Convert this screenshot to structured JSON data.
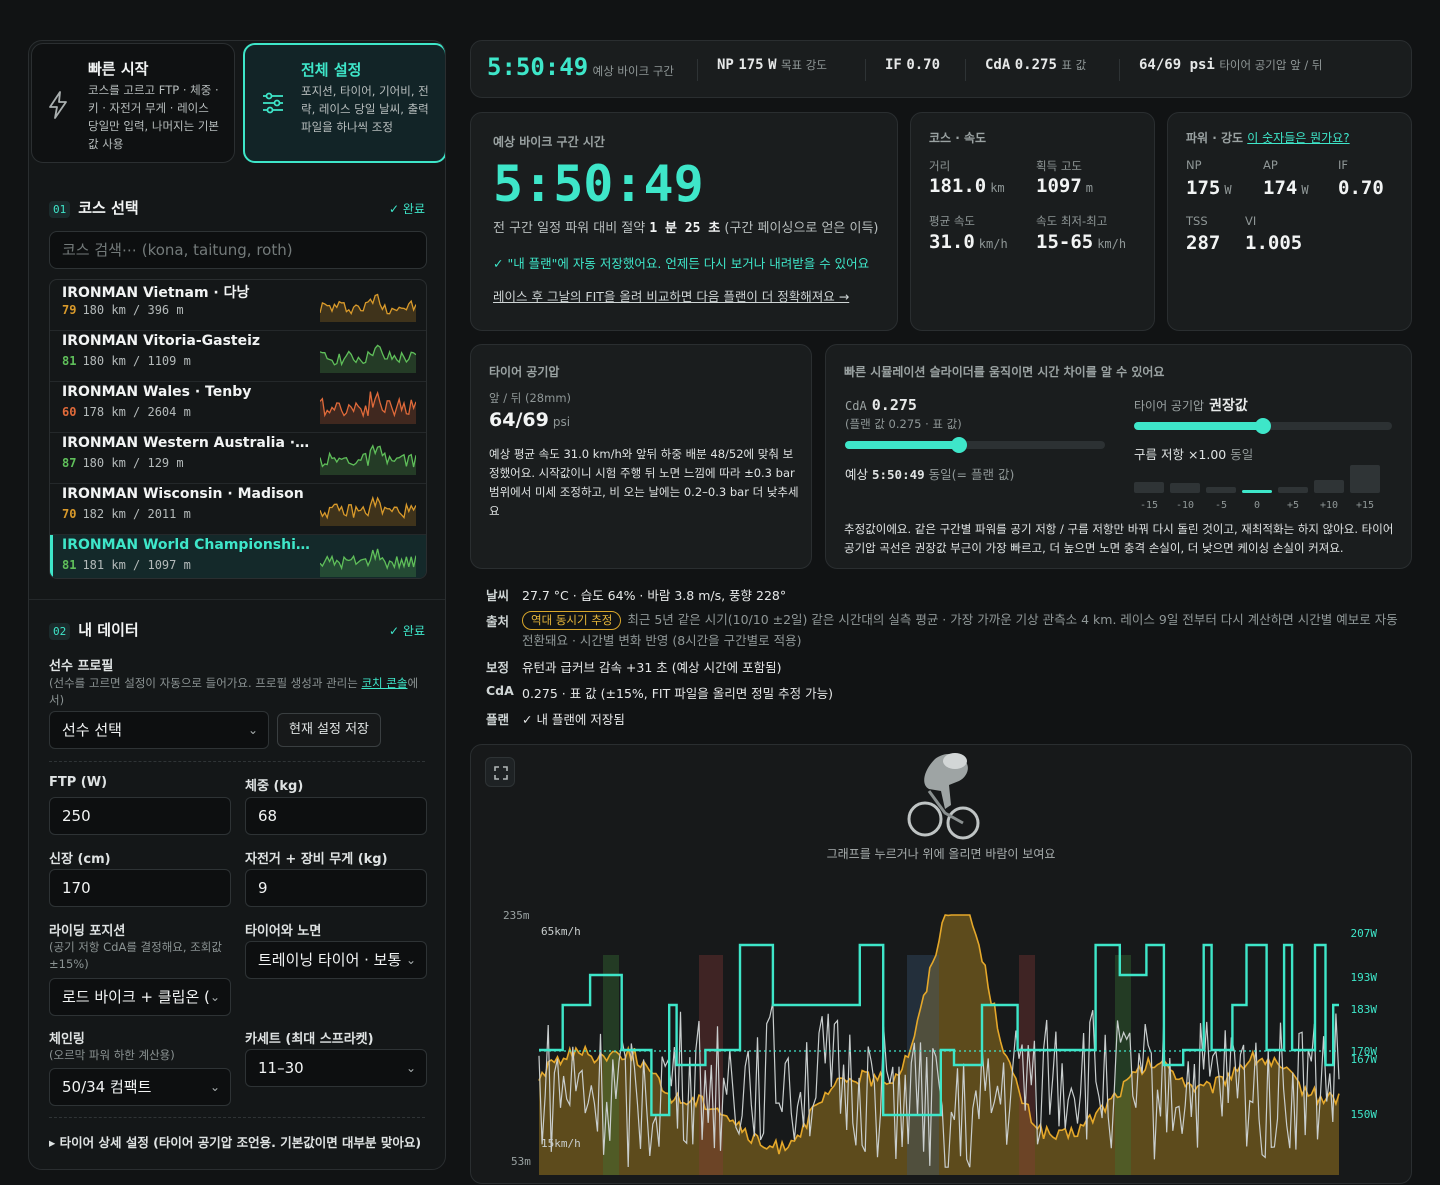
{
  "modes": {
    "quick": {
      "icon": "lightning-icon",
      "title": "빠른 시작",
      "desc": "코스를 고르고 FTP · 체중 · 키 · 자전거 무게 · 레이스 당일만 입력, 나머지는 기본값 사용"
    },
    "full": {
      "icon": "sliders-icon",
      "title": "전체 설정",
      "desc": "포지션, 타이어, 기어비, 전략, 레이스 당일 날씨, 출력 파일을 하나씩 조정"
    }
  },
  "course_section": {
    "num": "01",
    "title": "코스 선택",
    "done": "✓ 완료",
    "search_placeholder": "코스 검색⋯ (kona, taitung, roth)",
    "courses": [
      {
        "name": "IRONMAN Vietnam · 다낭",
        "score": "79",
        "meta": "180 km / 396 m",
        "color": "#d99a2b"
      },
      {
        "name": "IRONMAN Vitoria-Gasteiz",
        "score": "81",
        "meta": "180 km / 1109 m",
        "color": "#5fbf5a"
      },
      {
        "name": "IRONMAN Wales · Tenby",
        "score": "60",
        "meta": "178 km / 2604 m",
        "color": "#e06a3a"
      },
      {
        "name": "IRONMAN Western Australia · Bus⋯",
        "score": "87",
        "meta": "180 km / 129 m",
        "color": "#5fbf5a"
      },
      {
        "name": "IRONMAN Wisconsin · Madison",
        "score": "70",
        "meta": "182 km / 2011 m",
        "color": "#d99a2b"
      },
      {
        "name": "IRONMAN World Championship · ⋯",
        "score": "81",
        "meta": "181 km / 1097 m",
        "color": "#5fbf5a"
      }
    ]
  },
  "data_section": {
    "num": "02",
    "title": "내 데이터",
    "done": "✓ 완료",
    "profile_label": "선수 프로필",
    "profile_sub_a": "(선수를 고르면 설정이 자동으로 들어가요. 프로필 생성과 관리는 ",
    "profile_link": "코치 콘솔",
    "profile_sub_b": "에서)",
    "athlete_select": "선수 선택",
    "save_button": "현재 설정 저장",
    "ftp_label": "FTP  (W)",
    "ftp": "250",
    "weight_label": "체중 (kg)",
    "weight": "68",
    "height_label": "신장 (cm)",
    "height": "170",
    "bike_weight_label": "자전거 + 장비 무게 (kg)",
    "bike_weight": "9",
    "position_label": "라이딩 포지션",
    "position_sub": "(공기 저항 CdA를 결정해요, 조회값 ±15%)",
    "position": "로드 바이크 + 클립온 (",
    "tire_label": "타이어와 노면",
    "tire": "트레이닝 타이어 · 보통",
    "chainring_label": "체인링",
    "chainring_sub": "(오르막 파워 하한 계산용)",
    "chainring": "50/34 컴팩트",
    "cassette_label": "카세트 (최대 스프라켓)",
    "cassette": "11–30",
    "tire_detail": "▸ 타이어 상세 설정 (타이어 공기압 조언용. 기본값이면 대부분 맞아요)"
  },
  "topbar": {
    "time": "5:50:49",
    "time_cap": "예상 바이크 구간",
    "np_label": "NP",
    "np": "175",
    "np_unit": "W",
    "np_cap": "목표 강도",
    "if_label": "IF",
    "if": "0.70",
    "cda_label": "CdA",
    "cda": "0.275",
    "cda_cap": "표 값",
    "psi": "64/69 psi",
    "psi_cap": "타이어 공기압 앞 / 뒤"
  },
  "time_card": {
    "cap": "예상 바이크 구간 시간",
    "time": "5:50:49",
    "save_a": "전 구간 일정 파워 대비 절약 ",
    "save_val": "1 분 25 초",
    "save_b": " (구간 페이싱으로 얻은 이득)",
    "saved": "✓ \"내 플랜\"에 자동 저장했어요. 언제든 다시 보거나 내려받을 수 있어요",
    "fit_link": "레이스 후 그날의 FIT을 올려 비교하면 다음 플랜이 더 정확해져요 →"
  },
  "course_card": {
    "cap": "코스 · 속도",
    "dist_label": "거리",
    "dist": "181.0",
    "dist_unit": "km",
    "gain_label": "획득 고도",
    "gain": "1097",
    "gain_unit": "m",
    "avg_label": "평균 속도",
    "avg": "31.0",
    "avg_unit": "km/h",
    "range_label": "속도 최저-최고",
    "range": "15-65",
    "range_unit": "km/h"
  },
  "power_card": {
    "cap": "파워 · 강도",
    "link": "이 숫자들은 뭔가요?",
    "np_label": "NP",
    "np": "175",
    "np_unit": "W",
    "ap_label": "AP",
    "ap": "174",
    "ap_unit": "W",
    "if_label": "IF",
    "if": "0.70",
    "tss_label": "TSS",
    "tss": "287",
    "vi_label": "VI",
    "vi": "1.005"
  },
  "tire_card": {
    "cap": "타이어 공기압",
    "sub": "앞 / 뒤 (28mm)",
    "front": "64",
    "rear": "/69",
    "unit": "psi",
    "desc": "예상 평균 속도 31.0 km/h와 앞뒤 하중 배분 48/52에 맞춰 보정했어요. 시작값이니 시험 주행 뒤 노면 느낌에 따라 ±0.3 bar 범위에서 미세 조정하고, 비 오는 날에는 0.2–0.3 bar 더 낮추세요"
  },
  "sim_card": {
    "cap": "빠른 시뮬레이션 슬라이더를 움직이면 시간 차이를 알 수 있어요",
    "cda_label": "CdA",
    "cda": "0.275",
    "cda_sub": "(플랜 값 0.275 · 표 값)",
    "cda_level": 0.44,
    "result_a": "예상 ",
    "result_time": "5:50:49",
    "result_b": " 동일(= 플랜 값)",
    "tire_label": "타이어 공기압",
    "tire_val": "권장값",
    "tire_level": 0.5,
    "rr_a": "구름 저항 ×1.00",
    "rr_b": " 동일",
    "bars": [
      {
        "label": "-15",
        "v": 0.4
      },
      {
        "label": "-10",
        "v": 0.35
      },
      {
        "label": "-5",
        "v": 0.2
      },
      {
        "label": "0",
        "v": 0.12
      },
      {
        "label": "+5",
        "v": 0.2
      },
      {
        "label": "+10",
        "v": 0.45
      },
      {
        "label": "+15",
        "v": 1.0
      }
    ],
    "desc": "추정값이에요. 같은 구간별 파워를 공기 저항 / 구름 저항만 바꿔 다시 돌린 것이고, 재최적화는 하지 않아요. 타이어 공기압 곡선은 권장값 부근이 가장 빠르고, 더 높으면 노면 충격 손실이, 더 낮으면 케이싱 손실이 커져요."
  },
  "info": {
    "weather_key": "날씨",
    "weather": "27.7 °C · 습도 64% · 바람 3.8 m/s, 풍향 228°",
    "source_key": "출처",
    "source_badge": "역대 동시기 추정",
    "source": "최근 5년 같은 시기(10/10 ±2일) 같은 시간대의 실측 평균 · 가장 가까운 기상 관측소 4 km. 레이스 9일 전부터 다시 계산하면 시간별 예보로 자동 전환돼요 · 시간별 변화 반영 (8시간을 구간별로 적용)",
    "corr_key": "보정",
    "corr": "유턴과 급커브 감속 +31 초 (예상 시간에 포함됨)",
    "cda_key": "CdA",
    "cda": "0.275 · 표 값 (±15%, FIT 파일을 올리면 정밀 추정 가능)",
    "plan_key": "플랜",
    "plan": "✓ 내 플랜에 저장됨"
  },
  "graph": {
    "hint": "그래프를 누르거나 위에 올리면 바람이 보여요",
    "elev_top": "235m",
    "elev_bot": "53m",
    "spd_top": "65km/h",
    "spd_bot": "15km/h",
    "watts": [
      "207W",
      "193W",
      "183W",
      "170W",
      "167W",
      "150W"
    ]
  }
}
